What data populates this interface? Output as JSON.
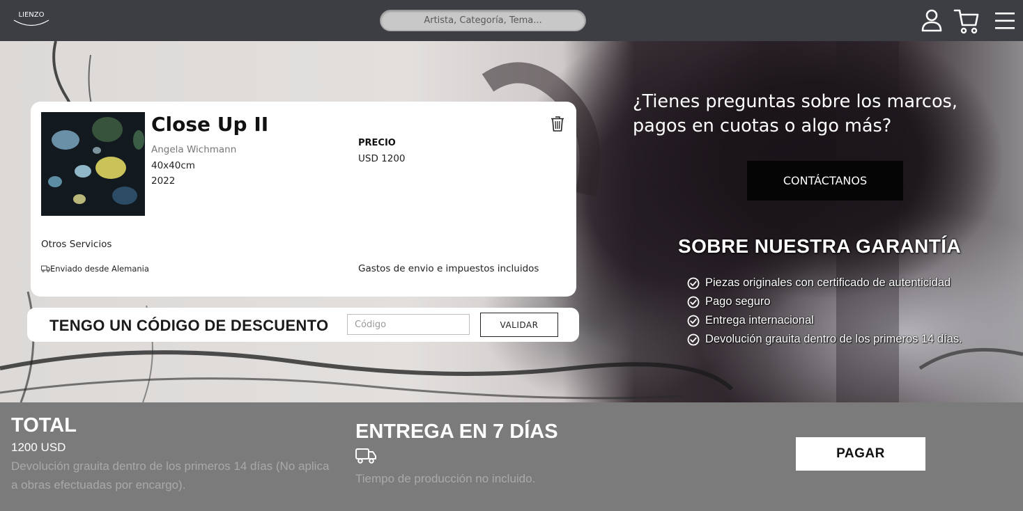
{
  "header": {
    "logo_text": "LIENZO",
    "search_placeholder": "Artista, Categoría, Tema...",
    "icons": [
      "user-icon",
      "cart-icon",
      "menu-icon"
    ]
  },
  "cart_item": {
    "title": "Close Up II",
    "artist": "Angela Wichmann",
    "size": "40x40cm",
    "year": "2022",
    "price_label": "PRECIO",
    "price_value": "USD 1200",
    "other_services": "Otros Servicios",
    "shipping_from": "Enviado desde Alemania",
    "shipping_note": "Gastos de envio e impuestos incluidos",
    "icons": [
      "trash-icon",
      "truck-icon"
    ]
  },
  "discount": {
    "label": "TENGO UN CÓDIGO DE DESCUENTO",
    "input_placeholder": "Código",
    "button_label": "VALIDAR"
  },
  "contact": {
    "question": "¿Tienes preguntas sobre los marcos, pagos en cuotas o algo más?",
    "button_label": "CONTÁCTANOS"
  },
  "guarantee": {
    "title": "SOBRE NUESTRA GARANTÍA",
    "items": [
      "Piezas originales con certificado de autenticidad",
      "Pago seguro",
      "Entrega internacional",
      "Devolución grauita dentro de los primeros 14 días."
    ],
    "icon": "check-circle-icon"
  },
  "summary": {
    "total_title": "TOTAL",
    "total_amount": "1200 USD",
    "return_note": "Devolución grauita dentro de los primeros 14 días (No aplica a obras efectuadas por encargo).",
    "delivery_title": "ENTREGA EN 7 DÍAS",
    "production_note": "Tiempo de producción no incluido.",
    "pay_button": "PAGAR"
  },
  "colors": {
    "header_bg": "#3c3e44",
    "footer_bg": "#7b7b7b",
    "card_bg": "#ffffff",
    "contact_button_bg": "#050505",
    "muted_text": "#a9a9a9"
  }
}
